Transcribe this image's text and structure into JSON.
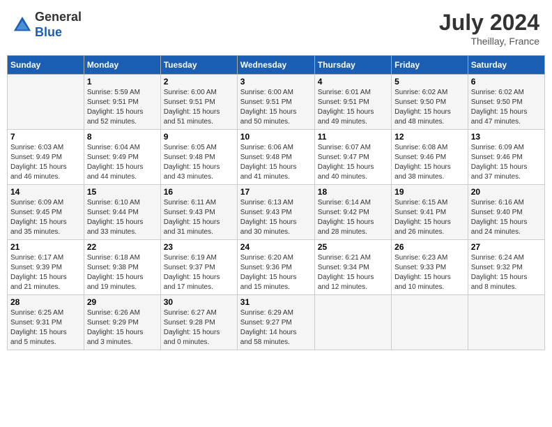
{
  "header": {
    "logo_general": "General",
    "logo_blue": "Blue",
    "month_year": "July 2024",
    "location": "Theillay, France"
  },
  "columns": [
    "Sunday",
    "Monday",
    "Tuesday",
    "Wednesday",
    "Thursday",
    "Friday",
    "Saturday"
  ],
  "weeks": [
    [
      {
        "day": "",
        "info": ""
      },
      {
        "day": "1",
        "info": "Sunrise: 5:59 AM\nSunset: 9:51 PM\nDaylight: 15 hours\nand 52 minutes."
      },
      {
        "day": "2",
        "info": "Sunrise: 6:00 AM\nSunset: 9:51 PM\nDaylight: 15 hours\nand 51 minutes."
      },
      {
        "day": "3",
        "info": "Sunrise: 6:00 AM\nSunset: 9:51 PM\nDaylight: 15 hours\nand 50 minutes."
      },
      {
        "day": "4",
        "info": "Sunrise: 6:01 AM\nSunset: 9:51 PM\nDaylight: 15 hours\nand 49 minutes."
      },
      {
        "day": "5",
        "info": "Sunrise: 6:02 AM\nSunset: 9:50 PM\nDaylight: 15 hours\nand 48 minutes."
      },
      {
        "day": "6",
        "info": "Sunrise: 6:02 AM\nSunset: 9:50 PM\nDaylight: 15 hours\nand 47 minutes."
      }
    ],
    [
      {
        "day": "7",
        "info": "Sunrise: 6:03 AM\nSunset: 9:49 PM\nDaylight: 15 hours\nand 46 minutes."
      },
      {
        "day": "8",
        "info": "Sunrise: 6:04 AM\nSunset: 9:49 PM\nDaylight: 15 hours\nand 44 minutes."
      },
      {
        "day": "9",
        "info": "Sunrise: 6:05 AM\nSunset: 9:48 PM\nDaylight: 15 hours\nand 43 minutes."
      },
      {
        "day": "10",
        "info": "Sunrise: 6:06 AM\nSunset: 9:48 PM\nDaylight: 15 hours\nand 41 minutes."
      },
      {
        "day": "11",
        "info": "Sunrise: 6:07 AM\nSunset: 9:47 PM\nDaylight: 15 hours\nand 40 minutes."
      },
      {
        "day": "12",
        "info": "Sunrise: 6:08 AM\nSunset: 9:46 PM\nDaylight: 15 hours\nand 38 minutes."
      },
      {
        "day": "13",
        "info": "Sunrise: 6:09 AM\nSunset: 9:46 PM\nDaylight: 15 hours\nand 37 minutes."
      }
    ],
    [
      {
        "day": "14",
        "info": "Sunrise: 6:09 AM\nSunset: 9:45 PM\nDaylight: 15 hours\nand 35 minutes."
      },
      {
        "day": "15",
        "info": "Sunrise: 6:10 AM\nSunset: 9:44 PM\nDaylight: 15 hours\nand 33 minutes."
      },
      {
        "day": "16",
        "info": "Sunrise: 6:11 AM\nSunset: 9:43 PM\nDaylight: 15 hours\nand 31 minutes."
      },
      {
        "day": "17",
        "info": "Sunrise: 6:13 AM\nSunset: 9:43 PM\nDaylight: 15 hours\nand 30 minutes."
      },
      {
        "day": "18",
        "info": "Sunrise: 6:14 AM\nSunset: 9:42 PM\nDaylight: 15 hours\nand 28 minutes."
      },
      {
        "day": "19",
        "info": "Sunrise: 6:15 AM\nSunset: 9:41 PM\nDaylight: 15 hours\nand 26 minutes."
      },
      {
        "day": "20",
        "info": "Sunrise: 6:16 AM\nSunset: 9:40 PM\nDaylight: 15 hours\nand 24 minutes."
      }
    ],
    [
      {
        "day": "21",
        "info": "Sunrise: 6:17 AM\nSunset: 9:39 PM\nDaylight: 15 hours\nand 21 minutes."
      },
      {
        "day": "22",
        "info": "Sunrise: 6:18 AM\nSunset: 9:38 PM\nDaylight: 15 hours\nand 19 minutes."
      },
      {
        "day": "23",
        "info": "Sunrise: 6:19 AM\nSunset: 9:37 PM\nDaylight: 15 hours\nand 17 minutes."
      },
      {
        "day": "24",
        "info": "Sunrise: 6:20 AM\nSunset: 9:36 PM\nDaylight: 15 hours\nand 15 minutes."
      },
      {
        "day": "25",
        "info": "Sunrise: 6:21 AM\nSunset: 9:34 PM\nDaylight: 15 hours\nand 12 minutes."
      },
      {
        "day": "26",
        "info": "Sunrise: 6:23 AM\nSunset: 9:33 PM\nDaylight: 15 hours\nand 10 minutes."
      },
      {
        "day": "27",
        "info": "Sunrise: 6:24 AM\nSunset: 9:32 PM\nDaylight: 15 hours\nand 8 minutes."
      }
    ],
    [
      {
        "day": "28",
        "info": "Sunrise: 6:25 AM\nSunset: 9:31 PM\nDaylight: 15 hours\nand 5 minutes."
      },
      {
        "day": "29",
        "info": "Sunrise: 6:26 AM\nSunset: 9:29 PM\nDaylight: 15 hours\nand 3 minutes."
      },
      {
        "day": "30",
        "info": "Sunrise: 6:27 AM\nSunset: 9:28 PM\nDaylight: 15 hours\nand 0 minutes."
      },
      {
        "day": "31",
        "info": "Sunrise: 6:29 AM\nSunset: 9:27 PM\nDaylight: 14 hours\nand 58 minutes."
      },
      {
        "day": "",
        "info": ""
      },
      {
        "day": "",
        "info": ""
      },
      {
        "day": "",
        "info": ""
      }
    ]
  ]
}
